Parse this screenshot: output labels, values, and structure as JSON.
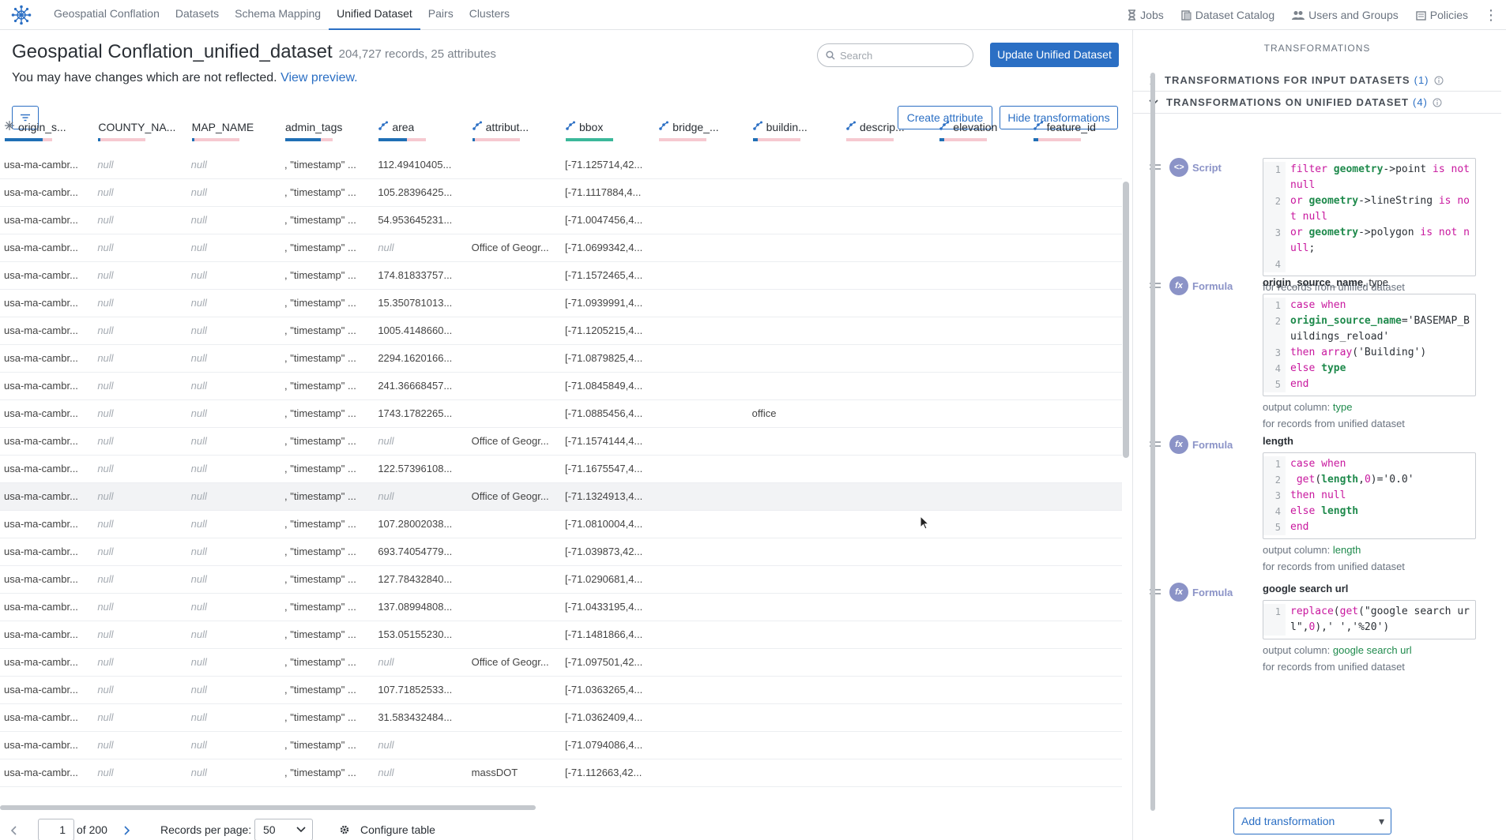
{
  "nav": {
    "tabs": [
      "Geospatial Conflation",
      "Datasets",
      "Schema Mapping",
      "Unified Dataset",
      "Pairs",
      "Clusters"
    ],
    "active_tab": "Unified Dataset",
    "right_links": {
      "jobs": "Jobs",
      "catalog": "Dataset Catalog",
      "users": "Users and Groups",
      "policies": "Policies"
    }
  },
  "header": {
    "title": "Geospatial Conflation_unified_dataset",
    "meta": "204,727 records, 25 attributes",
    "notice_text": "You may have changes which are not reflected.",
    "notice_link": "View preview.",
    "search_placeholder": "Search",
    "update_button": "Update Unified Dataset",
    "create_attribute_button": "Create attribute",
    "hide_transformations_button": "Hide transformations"
  },
  "table": {
    "columns": [
      {
        "label": "origin_s...",
        "icon": "asterisk-icon",
        "fill": 0.8,
        "color": "#1f6fb5"
      },
      {
        "label": "COUNTY_NA...",
        "icon": "",
        "fill": 0.05,
        "color": "#1f6fb5"
      },
      {
        "label": "MAP_NAME",
        "icon": "",
        "fill": 0.05,
        "color": "#1f6fb5"
      },
      {
        "label": "admin_tags",
        "icon": "",
        "fill": 0.75,
        "color": "#1f6fb5"
      },
      {
        "label": "area",
        "icon": "geo-icon",
        "fill": 0.6,
        "color": "#1f6fb5"
      },
      {
        "label": "attribut...",
        "icon": "geo-icon",
        "fill": 0.05,
        "color": "#1f6fb5"
      },
      {
        "label": "bbox",
        "icon": "geo-icon",
        "fill": 1.0,
        "color": "#3bb89a"
      },
      {
        "label": "bridge_...",
        "icon": "geo-icon",
        "fill": 0.0,
        "color": "#1f6fb5"
      },
      {
        "label": "buildin...",
        "icon": "geo-icon",
        "fill": 0.1,
        "color": "#1f6fb5"
      },
      {
        "label": "descrip...",
        "icon": "geo-icon",
        "fill": 0.0,
        "color": "#1f6fb5"
      },
      {
        "label": "elevation",
        "icon": "geo-icon",
        "fill": 0.1,
        "color": "#1f6fb5"
      },
      {
        "label": "feature_id",
        "icon": "geo-icon",
        "fill": 0.1,
        "color": "#1f6fb5"
      }
    ],
    "rows": [
      [
        "usa-ma-cambr...",
        "null",
        "null",
        ", \"timestamp\" ...",
        "112.49410405...",
        "",
        "[-71.125714,42...",
        "",
        "",
        "",
        "",
        ""
      ],
      [
        "usa-ma-cambr...",
        "null",
        "null",
        ", \"timestamp\" ...",
        "105.28396425...",
        "",
        "[-71.1117884,4...",
        "",
        "",
        "",
        "",
        ""
      ],
      [
        "usa-ma-cambr...",
        "null",
        "null",
        ", \"timestamp\" ...",
        "54.953645231...",
        "",
        "[-71.0047456,4...",
        "",
        "",
        "",
        "",
        ""
      ],
      [
        "usa-ma-cambr...",
        "null",
        "null",
        ", \"timestamp\" ...",
        "null",
        "Office of Geogr...",
        "[-71.0699342,4...",
        "",
        "",
        "",
        "",
        ""
      ],
      [
        "usa-ma-cambr...",
        "null",
        "null",
        ", \"timestamp\" ...",
        "174.81833757...",
        "",
        "[-71.1572465,4...",
        "",
        "",
        "",
        "",
        ""
      ],
      [
        "usa-ma-cambr...",
        "null",
        "null",
        ", \"timestamp\" ...",
        "15.350781013...",
        "",
        "[-71.0939991,4...",
        "",
        "",
        "",
        "",
        ""
      ],
      [
        "usa-ma-cambr...",
        "null",
        "null",
        ", \"timestamp\" ...",
        "1005.4148660...",
        "",
        "[-71.1205215,4...",
        "",
        "",
        "",
        "",
        ""
      ],
      [
        "usa-ma-cambr...",
        "null",
        "null",
        ", \"timestamp\" ...",
        "2294.1620166...",
        "",
        "[-71.0879825,4...",
        "",
        "",
        "",
        "",
        ""
      ],
      [
        "usa-ma-cambr...",
        "null",
        "null",
        ", \"timestamp\" ...",
        "241.36668457...",
        "",
        "[-71.0845849,4...",
        "",
        "",
        "",
        "",
        ""
      ],
      [
        "usa-ma-cambr...",
        "null",
        "null",
        ", \"timestamp\" ...",
        "1743.1782265...",
        "",
        "[-71.0885456,4...",
        "",
        "office",
        "",
        "",
        ""
      ],
      [
        "usa-ma-cambr...",
        "null",
        "null",
        ", \"timestamp\" ...",
        "null",
        "Office of Geogr...",
        "[-71.1574144,4...",
        "",
        "",
        "",
        "",
        ""
      ],
      [
        "usa-ma-cambr...",
        "null",
        "null",
        ", \"timestamp\" ...",
        "122.57396108...",
        "",
        "[-71.1675547,4...",
        "",
        "",
        "",
        "",
        ""
      ],
      [
        "usa-ma-cambr...",
        "null",
        "null",
        ", \"timestamp\" ...",
        "null",
        "Office of Geogr...",
        "[-71.1324913,4...",
        "",
        "",
        "",
        "",
        ""
      ],
      [
        "usa-ma-cambr...",
        "null",
        "null",
        ", \"timestamp\" ...",
        "107.28002038...",
        "",
        "[-71.0810004,4...",
        "",
        "",
        "",
        "",
        ""
      ],
      [
        "usa-ma-cambr...",
        "null",
        "null",
        ", \"timestamp\" ...",
        "693.74054779...",
        "",
        "[-71.039873,42...",
        "",
        "",
        "",
        "",
        ""
      ],
      [
        "usa-ma-cambr...",
        "null",
        "null",
        ", \"timestamp\" ...",
        "127.78432840...",
        "",
        "[-71.0290681,4...",
        "",
        "",
        "",
        "",
        ""
      ],
      [
        "usa-ma-cambr...",
        "null",
        "null",
        ", \"timestamp\" ...",
        "137.08994808...",
        "",
        "[-71.0433195,4...",
        "",
        "",
        "",
        "",
        ""
      ],
      [
        "usa-ma-cambr...",
        "null",
        "null",
        ", \"timestamp\" ...",
        "153.05155230...",
        "",
        "[-71.1481866,4...",
        "",
        "",
        "",
        "",
        ""
      ],
      [
        "usa-ma-cambr...",
        "null",
        "null",
        ", \"timestamp\" ...",
        "null",
        "Office of Geogr...",
        "[-71.097501,42...",
        "",
        "",
        "",
        "",
        ""
      ],
      [
        "usa-ma-cambr...",
        "null",
        "null",
        ", \"timestamp\" ...",
        "107.71852533...",
        "",
        "[-71.0363265,4...",
        "",
        "",
        "",
        "",
        ""
      ],
      [
        "usa-ma-cambr...",
        "null",
        "null",
        ", \"timestamp\" ...",
        "31.583432484...",
        "",
        "[-71.0362409,4...",
        "",
        "",
        "",
        "",
        ""
      ],
      [
        "usa-ma-cambr...",
        "null",
        "null",
        ", \"timestamp\" ...",
        "null",
        "",
        "[-71.0794086,4...",
        "",
        "",
        "",
        "",
        ""
      ],
      [
        "usa-ma-cambr...",
        "null",
        "null",
        ", \"timestamp\" ...",
        "null",
        "massDOT",
        "[-71.112663,42...",
        "",
        "",
        "",
        "",
        ""
      ]
    ],
    "hover_row": 12
  },
  "pager": {
    "page": "1",
    "of_total": "of 200",
    "records_per_page_label": "Records per page:",
    "per_page_value": "50",
    "configure_label": "Configure table"
  },
  "panel": {
    "title": "TRANSFORMATIONS",
    "input_section": {
      "label": "TRANSFORMATIONS FOR INPUT DATASETS",
      "count": "(1)"
    },
    "unified_section": {
      "label": "TRANSFORMATIONS ON UNIFIED DATASET",
      "count": "(4)"
    },
    "transformations": [
      {
        "kind": "Script",
        "target_bold": "",
        "target_rest": "",
        "lines": [
          [
            [
              "kw",
              "filter "
            ],
            [
              "id",
              "geometry"
            ],
            [
              "st",
              "->point "
            ],
            [
              "kw",
              "is"
            ],
            [
              "st",
              " "
            ],
            [
              "kw",
              "not null"
            ]
          ],
          [
            [
              "kw",
              "or "
            ],
            [
              "id",
              "geometry"
            ],
            [
              "st",
              "->lineString "
            ],
            [
              "kw",
              "is"
            ],
            [
              "st",
              " "
            ],
            [
              "kw",
              "not null"
            ]
          ],
          [
            [
              "kw",
              "or "
            ],
            [
              "id",
              "geometry"
            ],
            [
              "st",
              "->polygon "
            ],
            [
              "kw",
              "is"
            ],
            [
              "st",
              " "
            ],
            [
              "kw",
              "not null"
            ],
            [
              "st",
              ";"
            ]
          ],
          []
        ],
        "output_label": "",
        "output_value": "",
        "scope": "for records from unified dataset"
      },
      {
        "kind": "Formula",
        "target_bold": "origin_source_name",
        "target_rest": ", type",
        "lines": [
          [
            [
              "kw",
              "case when"
            ]
          ],
          [
            [
              "id",
              "origin_source_name"
            ],
            [
              "st",
              "='BASEMAP_Buildings_reload'"
            ]
          ],
          [
            [
              "kw",
              "then "
            ],
            [
              "kw",
              "array"
            ],
            [
              "st",
              "('Building')"
            ]
          ],
          [
            [
              "kw",
              "else "
            ],
            [
              "id",
              "type"
            ]
          ],
          [
            [
              "kw",
              "end"
            ]
          ]
        ],
        "line_numbers": [
          "1",
          "",
          "2",
          "3",
          "4"
        ],
        "output_label": "output column: ",
        "output_value": "type",
        "scope": "for records from unified dataset"
      },
      {
        "kind": "Formula",
        "target_bold": "length",
        "target_rest": "",
        "lines": [
          [
            [
              "kw",
              "case when"
            ]
          ],
          [
            [
              "st",
              " "
            ],
            [
              "kw",
              "get"
            ],
            [
              "st",
              "("
            ],
            [
              "id",
              "length"
            ],
            [
              "st",
              ","
            ],
            [
              "kw",
              "0"
            ],
            [
              "st",
              ")='0.0'"
            ]
          ],
          [
            [
              "kw",
              "then null"
            ]
          ],
          [
            [
              "kw",
              "else "
            ],
            [
              "id",
              "length"
            ]
          ],
          [
            [
              "kw",
              "end"
            ]
          ]
        ],
        "output_label": "output column: ",
        "output_value": "length",
        "scope": "for records from unified dataset"
      },
      {
        "kind": "Formula",
        "target_bold": "google search url",
        "target_rest": "",
        "lines": [
          [
            [
              "kw",
              "replace"
            ],
            [
              "st",
              "("
            ],
            [
              "kw",
              "get"
            ],
            [
              "st",
              "(\"google search url\","
            ],
            [
              "kw",
              "0"
            ],
            [
              "st",
              "),' ','%20')"
            ]
          ]
        ],
        "output_label": "output column: ",
        "output_value": "google search url",
        "scope": "for records from unified dataset"
      }
    ],
    "add_button": "Add transformation"
  }
}
